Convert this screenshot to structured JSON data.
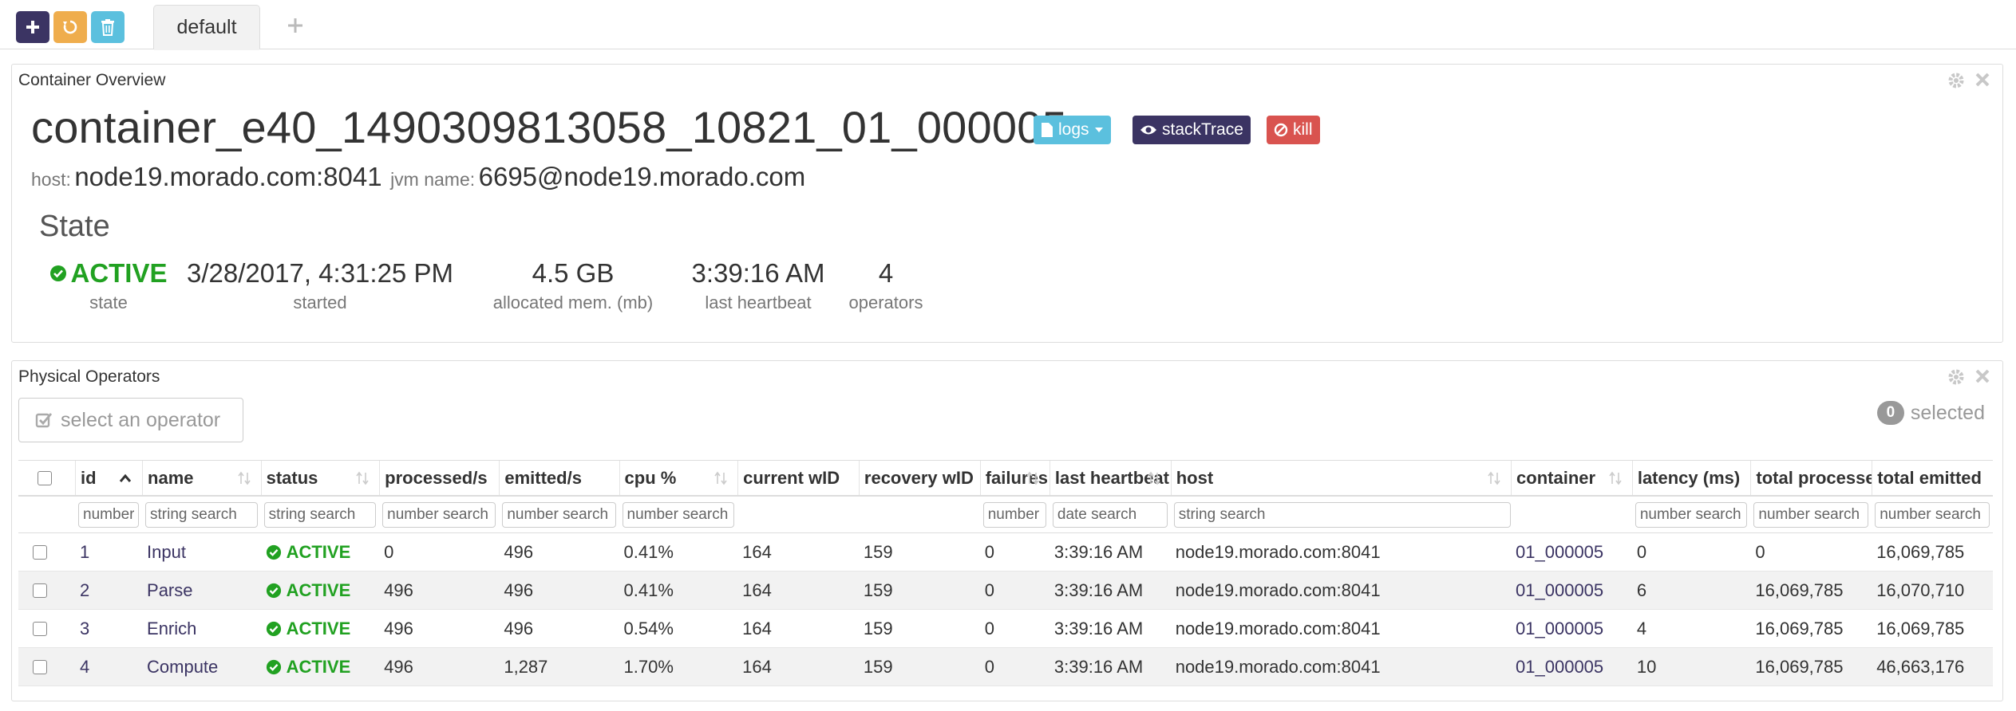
{
  "toolbar": {
    "tabs": [
      {
        "label": "default"
      }
    ]
  },
  "overview": {
    "panel_title": "Container Overview",
    "container_id": "container_e40_1490309813058_10821_01_000005",
    "labels": {
      "logs": "logs",
      "stack_trace": "stackTrace",
      "kill": "kill"
    },
    "host_label": "host:",
    "host_value": "node19.morado.com:8041",
    "jvm_label": "jvm name:",
    "jvm_value": "6695@node19.morado.com",
    "state_heading": "State",
    "stats": [
      {
        "value": "ACTIVE",
        "key": "state"
      },
      {
        "value": "3/28/2017, 4:31:25 PM",
        "key": "started"
      },
      {
        "value": "4.5 GB",
        "key": "allocated mem. (mb)"
      },
      {
        "value": "3:39:16 AM",
        "key": "last heartbeat"
      },
      {
        "value": "4",
        "key": "operators"
      }
    ]
  },
  "operators": {
    "panel_title": "Physical Operators",
    "select_label": "select an operator",
    "selected_count": "0",
    "selected_label": "selected",
    "columns": [
      {
        "label": "",
        "filter": ""
      },
      {
        "label": "id",
        "filter": "number"
      },
      {
        "label": "name",
        "filter": "string search"
      },
      {
        "label": "status",
        "filter": "string search"
      },
      {
        "label": "processed/s",
        "filter": "number search"
      },
      {
        "label": "emitted/s",
        "filter": "number search"
      },
      {
        "label": "cpu %",
        "filter": "number search"
      },
      {
        "label": "current wID",
        "filter": ""
      },
      {
        "label": "recovery wID",
        "filter": ""
      },
      {
        "label": "failures",
        "filter": "number"
      },
      {
        "label": "last heartbeat",
        "filter": "date search"
      },
      {
        "label": "host",
        "filter": "string search"
      },
      {
        "label": "container",
        "filter": ""
      },
      {
        "label": "latency (ms)",
        "filter": "number search"
      },
      {
        "label": "total processed",
        "filter": "number search"
      },
      {
        "label": "total emitted",
        "filter": "number search"
      }
    ],
    "rows": [
      [
        "1",
        "Input",
        "ACTIVE",
        "0",
        "496",
        "0.41%",
        "164",
        "159",
        "0",
        "3:39:16 AM",
        "node19.morado.com:8041",
        "01_000005",
        "0",
        "0",
        "16,069,785"
      ],
      [
        "2",
        "Parse",
        "ACTIVE",
        "496",
        "496",
        "0.41%",
        "164",
        "159",
        "0",
        "3:39:16 AM",
        "node19.morado.com:8041",
        "01_000005",
        "6",
        "16,069,785",
        "16,070,710"
      ],
      [
        "3",
        "Enrich",
        "ACTIVE",
        "496",
        "496",
        "0.54%",
        "164",
        "159",
        "0",
        "3:39:16 AM",
        "node19.morado.com:8041",
        "01_000005",
        "4",
        "16,069,785",
        "16,069,785"
      ],
      [
        "4",
        "Compute",
        "ACTIVE",
        "496",
        "1,287",
        "1.70%",
        "164",
        "159",
        "0",
        "3:39:16 AM",
        "node19.morado.com:8041",
        "01_000005",
        "10",
        "16,069,785",
        "46,663,176"
      ]
    ]
  },
  "colors": {
    "primary": "#3b3463",
    "warning": "#efad4d",
    "info": "#5bc0de",
    "danger": "#d9534f",
    "success": "#21a121"
  }
}
